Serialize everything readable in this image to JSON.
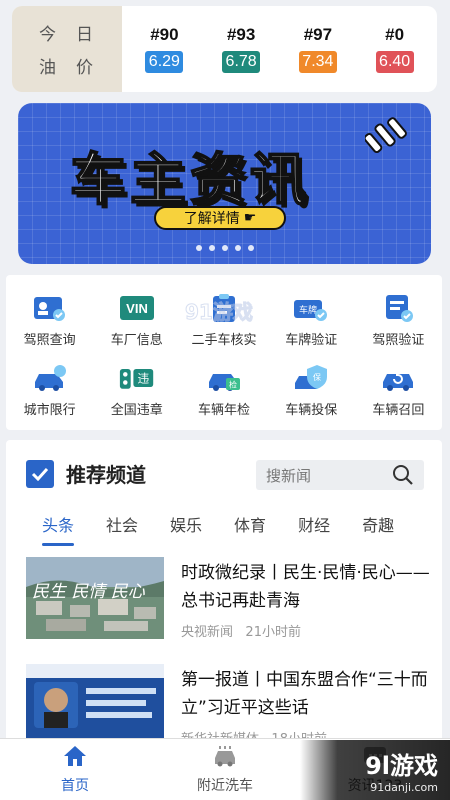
{
  "oil": {
    "label_chars": [
      "今",
      "日",
      "油",
      "价"
    ],
    "items": [
      {
        "grade": "#90",
        "price": "6.29",
        "color": "#2f8be0"
      },
      {
        "grade": "#93",
        "price": "6.78",
        "color": "#1f8a7c"
      },
      {
        "grade": "#97",
        "price": "7.34",
        "color": "#f0892a"
      },
      {
        "grade": "#0",
        "price": "6.40",
        "color": "#e05258"
      }
    ]
  },
  "banner": {
    "title": "车主资讯",
    "button": "了解详情",
    "slides": 5
  },
  "services": [
    {
      "label": "驾照查询",
      "icon": "license-icon"
    },
    {
      "label": "车厂信息",
      "icon": "vin-icon"
    },
    {
      "label": "二手车核实",
      "icon": "used-car-doc-icon"
    },
    {
      "label": "车牌验证",
      "icon": "license-plate-icon"
    },
    {
      "label": "驾照验证",
      "icon": "license-verify-icon"
    },
    {
      "label": "城市限行",
      "icon": "car-restriction-icon"
    },
    {
      "label": "全国违章",
      "icon": "traffic-violation-icon"
    },
    {
      "label": "车辆年检",
      "icon": "annual-inspection-icon"
    },
    {
      "label": "车辆投保",
      "icon": "insurance-icon"
    },
    {
      "label": "车辆召回",
      "icon": "recall-icon"
    }
  ],
  "recommend": {
    "title": "推荐频道",
    "search_placeholder": "搜新闻",
    "tabs": [
      "头条",
      "社会",
      "娱乐",
      "体育",
      "财经",
      "奇趣"
    ],
    "active_tab": 0,
    "news": [
      {
        "title": "时政微纪录丨民生·民情·民心——总书记再赴青海",
        "source": "央视新闻",
        "time": "21小时前"
      },
      {
        "title": "第一报道丨中国东盟合作“三十而立”习近平这些话",
        "source": "新华社新媒体",
        "time": "18小时前"
      }
    ]
  },
  "bottom_nav": [
    {
      "label": "首页",
      "icon": "home-icon",
      "active": true
    },
    {
      "label": "附近洗车",
      "icon": "car-wash-icon",
      "active": false
    },
    {
      "label": "资讯123",
      "icon": "news-icon",
      "active": false
    }
  ],
  "watermark": {
    "center": "91游戏",
    "center_url": "91danji.com",
    "corner": "9l游戏",
    "corner_url": "91danji.com"
  }
}
